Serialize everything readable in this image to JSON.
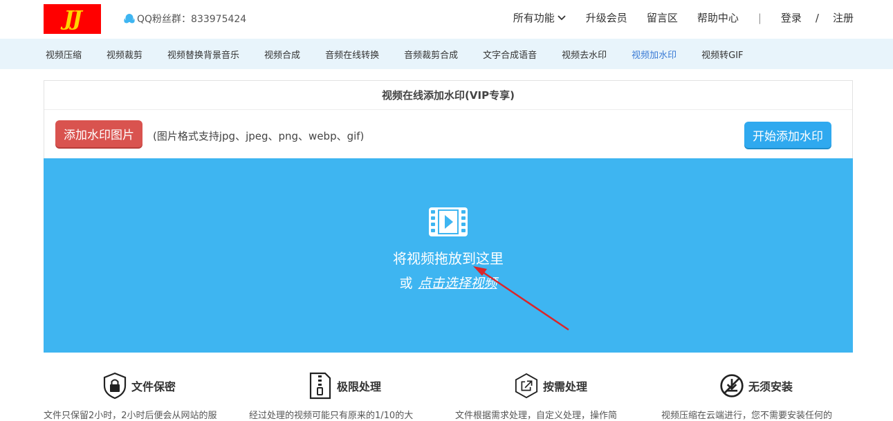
{
  "logo": {
    "text": "JJ"
  },
  "qq": {
    "label": "QQ粉丝群：833975424"
  },
  "topnav": {
    "all_features": "所有功能",
    "upgrade": "升级会员",
    "message": "留言区",
    "help": "帮助中心",
    "separator": "|",
    "login": "登录",
    "slash": "/",
    "register": "注册"
  },
  "tools": [
    {
      "label": "视频压缩"
    },
    {
      "label": "视频裁剪"
    },
    {
      "label": "视频替换背景音乐"
    },
    {
      "label": "视频合成"
    },
    {
      "label": "音频在线转换"
    },
    {
      "label": "音频裁剪合成"
    },
    {
      "label": "文字合成语音"
    },
    {
      "label": "视频去水印"
    },
    {
      "label": "视频加水印"
    },
    {
      "label": "视频转GIF"
    }
  ],
  "panel": {
    "title": "视频在线添加水印(VIP专享)",
    "add_image_button": "添加水印图片",
    "format_hint": "(图片格式支持jpg、jpeg、png、webp、gif)",
    "start_button": "开始添加水印",
    "drop_text": "将视频拖放到这里",
    "or_text": "或",
    "select_link": "点击选择视频"
  },
  "features": [
    {
      "title": "文件保密",
      "icon": "lock-shield-icon",
      "desc": "文件只保留2小时，2小时后便会从网站的服"
    },
    {
      "title": "极限处理",
      "icon": "zip-file-icon",
      "desc": "经过处理的视频可能只有原来的1/10的大"
    },
    {
      "title": "按需处理",
      "icon": "external-link-hexagon-icon",
      "desc": "文件根据需求处理，自定义处理，操作简"
    },
    {
      "title": "无须安装",
      "icon": "no-download-icon",
      "desc": "视频压缩在云端进行，您不需要安装任何的"
    }
  ],
  "colors": {
    "logo_bg": "#ff0000",
    "logo_text": "#ffd400",
    "toolbar_bg": "#e8f4fb",
    "active_tool": "#3a7bd5",
    "red_button": "#d9534f",
    "blue_button": "#2fa9ef",
    "dropzone": "#3eb5f1",
    "arrow": "#d9262a"
  }
}
